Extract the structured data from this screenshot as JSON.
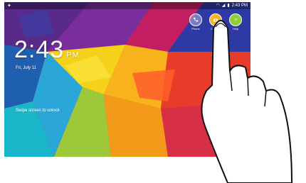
{
  "status_bar": {
    "time": "2:43 PM",
    "icons": [
      "notification-icon",
      "wifi-icon",
      "signal-icon",
      "battery-icon"
    ]
  },
  "lock_screen": {
    "time": "2:43",
    "ampm": "PM",
    "date": "Fri, July 11",
    "unlock_hint": "Swipe screen to unlock",
    "shortcuts": [
      {
        "label": "Phone",
        "icon": "phone-icon"
      },
      {
        "label": "Camera",
        "icon": "camera-icon"
      },
      {
        "label": "Help",
        "icon": "help-icon"
      }
    ]
  },
  "colors": {
    "accent": "#e8412a",
    "wallpaper": [
      "#5a2a8a",
      "#1e73c8",
      "#19b5c9",
      "#f5d21a",
      "#f39a1b",
      "#e83c2a",
      "#c41e63",
      "#2e3aa3"
    ]
  }
}
